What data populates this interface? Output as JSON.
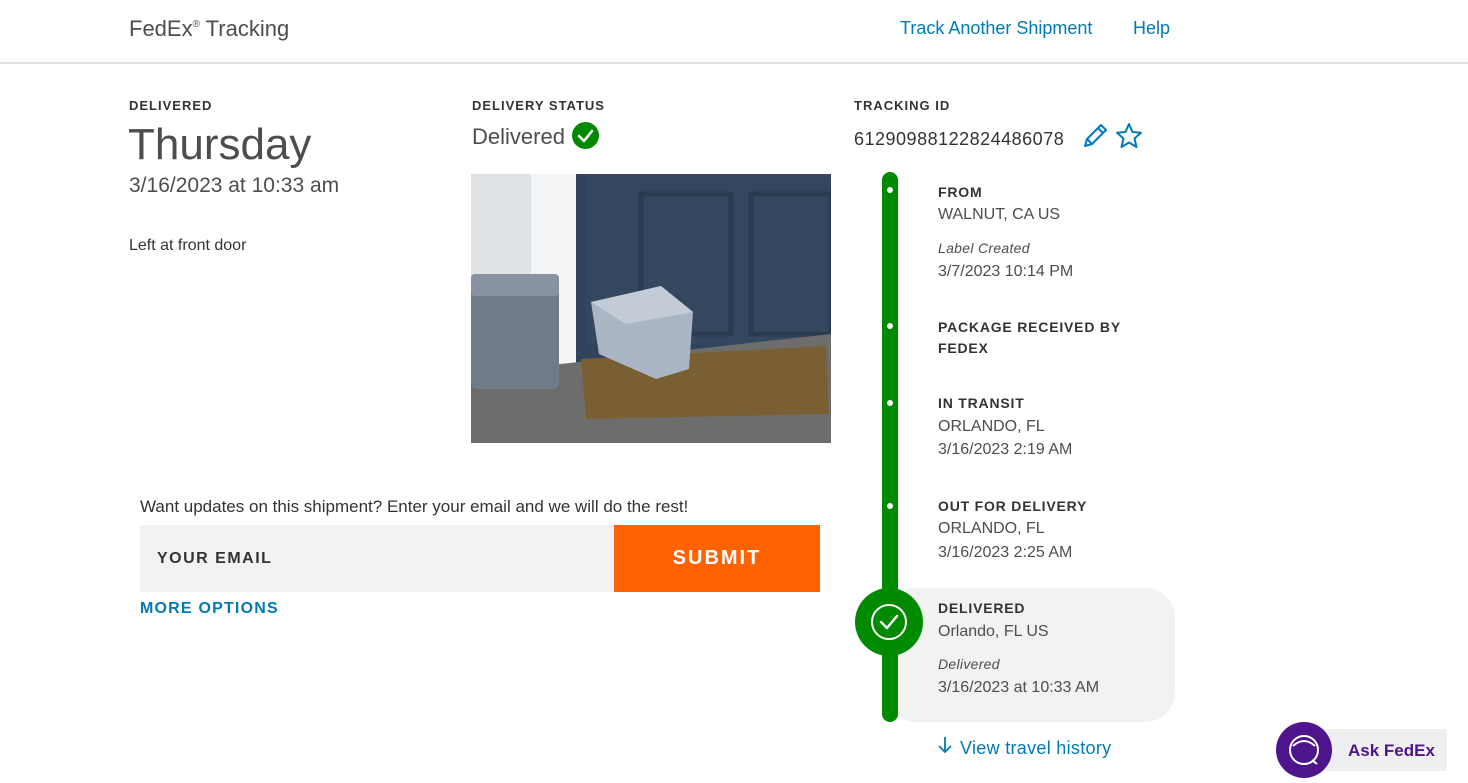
{
  "header": {
    "brand": "FedEx",
    "brand_reg": "®",
    "brand_suffix": " Tracking",
    "track_another": "Track Another Shipment",
    "help": "Help"
  },
  "summary": {
    "delivered_label": "DELIVERED",
    "day": "Thursday",
    "datetime": "3/16/2023 at 10:33 am",
    "note": "Left at front door"
  },
  "status": {
    "label": "DELIVERY STATUS",
    "value": "Delivered",
    "status_color": "#008a00"
  },
  "tracking": {
    "label": "TRACKING ID",
    "number": "612909881228244860​78",
    "edit_icon": "pencil-icon",
    "favorite_icon": "star-icon"
  },
  "timeline": {
    "events": [
      {
        "title": "FROM",
        "line1": "WALNUT, CA US",
        "italic": "Label Created",
        "line2": "3/7/2023 10:14 PM"
      },
      {
        "title": "PACKAGE RECEIVED BY FEDEX"
      },
      {
        "title": "IN TRANSIT",
        "line1": "ORLANDO, FL",
        "line2": "3/16/2023 2:19 AM"
      },
      {
        "title": "OUT FOR DELIVERY",
        "line1": "ORLANDO, FL",
        "line2": "3/16/2023 2:25 AM"
      },
      {
        "title": "DELIVERED",
        "line1": "Orlando, FL US",
        "italic": "Delivered",
        "line2": "3/16/2023 at 10:33 AM"
      }
    ],
    "view_history": "View travel history"
  },
  "updates": {
    "prompt": "Want updates on this shipment? Enter your email and we will do the rest!",
    "email_placeholder": "YOUR EMAIL",
    "submit": "SUBMIT",
    "more_options": "MORE OPTIONS"
  },
  "assistant": {
    "label": "Ask FedEx",
    "brand_color": "#4d148c"
  },
  "colors": {
    "link": "#007ab7",
    "accent": "#ff6200",
    "success": "#008a00"
  }
}
